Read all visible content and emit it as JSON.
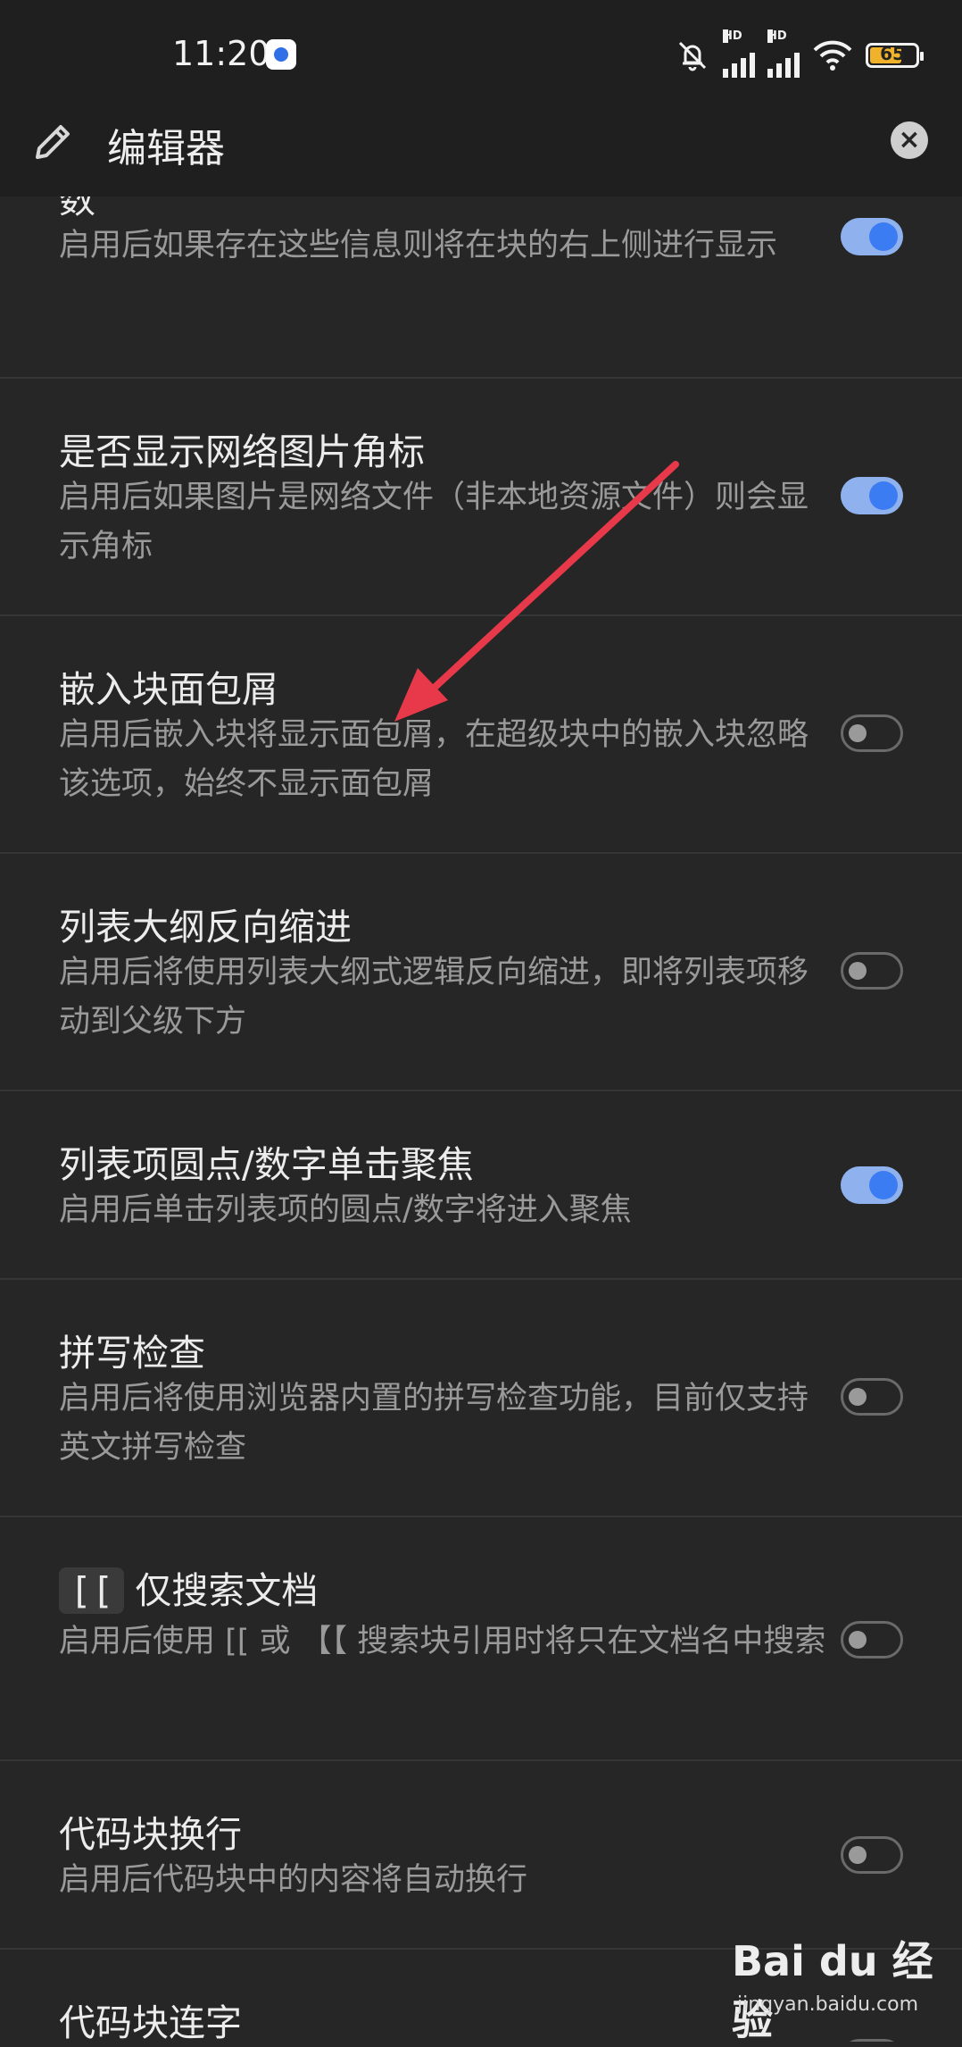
{
  "status": {
    "time": "11:20",
    "battery": "65",
    "network1": "HD",
    "network2": "HD"
  },
  "header": {
    "title": "编辑器"
  },
  "settings": [
    {
      "title": "数",
      "desc": "启用后如果存在这些信息则将在块的右上侧进行显示",
      "enabled": true
    },
    {
      "title": "是否显示网络图片角标",
      "desc": "启用后如果图片是网络文件（非本地资源文件）则会显示角标",
      "enabled": true
    },
    {
      "title": "嵌入块面包屑",
      "desc": "启用后嵌入块将显示面包屑，在超级块中的嵌入块忽略该选项，始终不显示面包屑",
      "enabled": false
    },
    {
      "title": "列表大纲反向缩进",
      "desc": "启用后将使用列表大纲式逻辑反向缩进，即将列表项移动到父级下方",
      "enabled": false
    },
    {
      "title": "列表项圆点/数字单击聚焦",
      "desc": "启用后单击列表项的圆点/数字将进入聚焦",
      "enabled": true
    },
    {
      "title": "拼写检查",
      "desc": "启用后将使用浏览器内置的拼写检查功能，目前仅支持英文拼写检查",
      "enabled": false
    },
    {
      "title": "仅搜索文档",
      "title_chip": "[[",
      "desc": "启用后使用 [[ 或 【【 搜索块引用时将只在文档名中搜索",
      "enabled": false
    },
    {
      "title": "代码块换行",
      "desc": "启用后代码块中的内容将自动换行",
      "enabled": false
    },
    {
      "title": "代码块连字",
      "enabled": false
    }
  ],
  "watermark": {
    "brand": "Bai du 经验",
    "site": "jingyan.baidu.com"
  },
  "colors": {
    "background": "#262626",
    "header": "#1f1f1f",
    "accent": "#3c7cf2",
    "arrow": "#e8394a"
  }
}
